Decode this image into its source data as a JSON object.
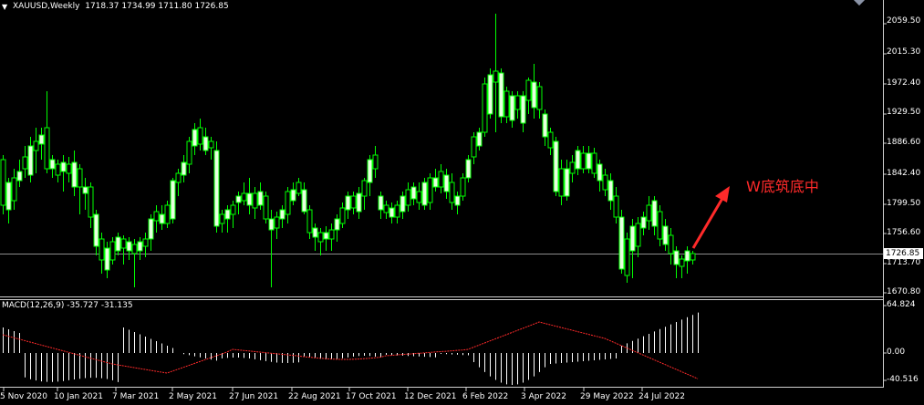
{
  "chart": {
    "symbol_title": "XAUUSD,Weekly",
    "ohlc": "1718.37 1734.99 1711.80 1726.85",
    "current_price_label": "1726.85",
    "annotation": "W底筑底中",
    "menu_icon": "triangle-down-icon",
    "colors": {
      "background": "#000000",
      "bull_candle_fill": "#e8ffe0",
      "candle_outline": "#00ff00",
      "macd_histogram": "#ffffff",
      "signal_line": "#ff2a2a",
      "annotation": "#ff2a2a",
      "price_line": "#8c8c8c"
    }
  },
  "price_axis": {
    "labels": [
      "2059.50",
      "2015.30",
      "1972.40",
      "1929.50",
      "1886.60",
      "1842.40",
      "1799.50",
      "1756.60",
      "1713.70",
      "1670.80"
    ]
  },
  "macd": {
    "title": "MACD(12,26,9) -35.727 -31.135",
    "axis_labels": [
      "64.824",
      "0.00",
      "-40.516"
    ]
  },
  "time_axis": {
    "labels": [
      "5 Nov 2020",
      "10 Jan 2021",
      "7 Mar 2021",
      "2 May 2021",
      "27 Jun 2021",
      "22 Aug 2021",
      "17 Oct 2021",
      "12 Dec 2021",
      "6 Feb 2022",
      "3 Apr 2022",
      "29 May 2022",
      "24 Jul 2022"
    ]
  }
}
